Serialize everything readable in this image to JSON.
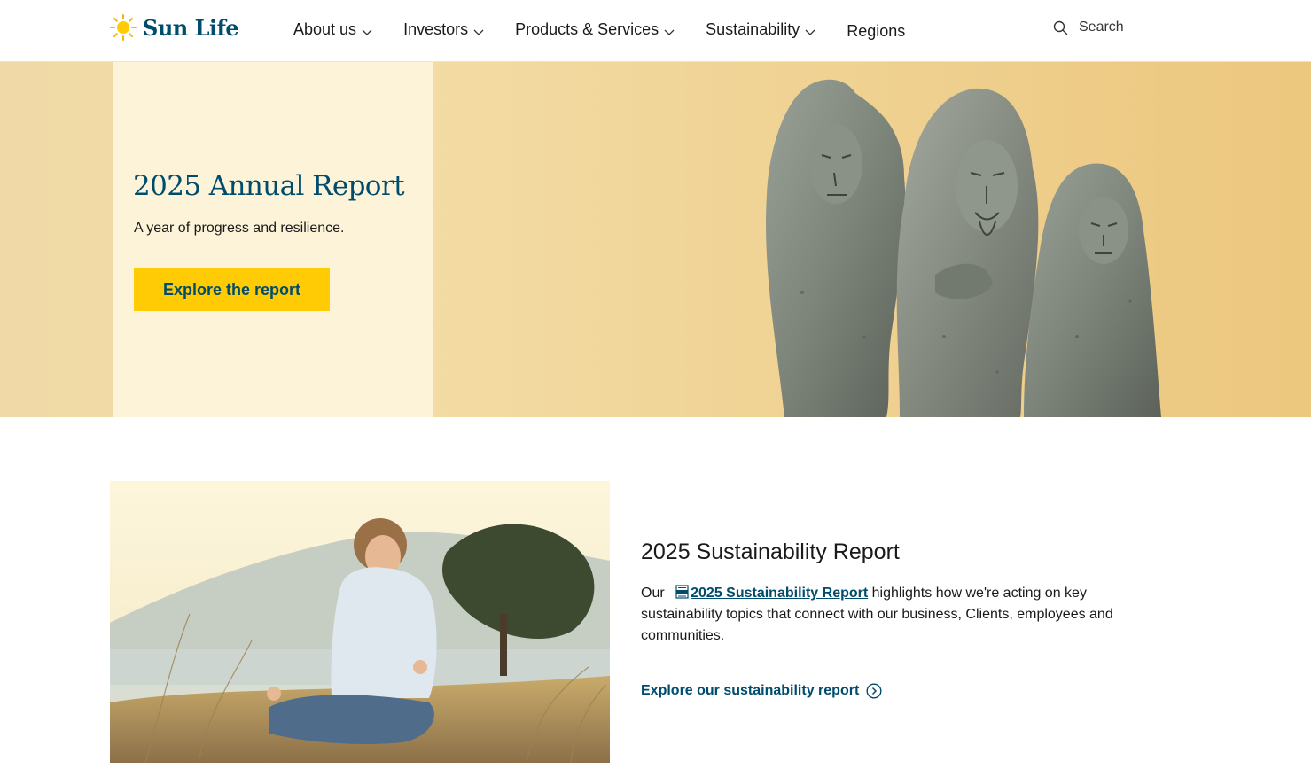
{
  "header": {
    "logo_text": "Sun Life",
    "nav": [
      {
        "label": "About us",
        "has_dropdown": true
      },
      {
        "label": "Investors",
        "has_dropdown": true
      },
      {
        "label": "Products & Services",
        "has_dropdown": true
      },
      {
        "label": "Sustainability",
        "has_dropdown": true
      },
      {
        "label": "Regions",
        "has_dropdown": false
      }
    ],
    "search_label": "Search"
  },
  "hero": {
    "title": "2025 Annual Report",
    "subtitle": "A year of progress and resilience.",
    "button_label": "Explore the report",
    "image": "stone-sculpture-three-figures"
  },
  "sustainability": {
    "image": "child-meditating-outdoors",
    "title": "2025 Sustainability Report",
    "body_prefix": "Our",
    "link_label": "2025 Sustainability Report",
    "body_suffix": "highlights how we're acting on key sustainability topics that connect with our business, Clients, employees and communities.",
    "cta_label": "Explore our sustainability report"
  },
  "colors": {
    "brand_blue": "#004c6c",
    "brand_yellow": "#ffcb05",
    "hero_card_bg": "#fdf3d8",
    "hero_bg": "#ecc77e"
  },
  "icons": [
    "sun-logo-icon",
    "chevron-down-icon",
    "search-icon",
    "pdf-icon",
    "arrow-circle-right-icon"
  ]
}
